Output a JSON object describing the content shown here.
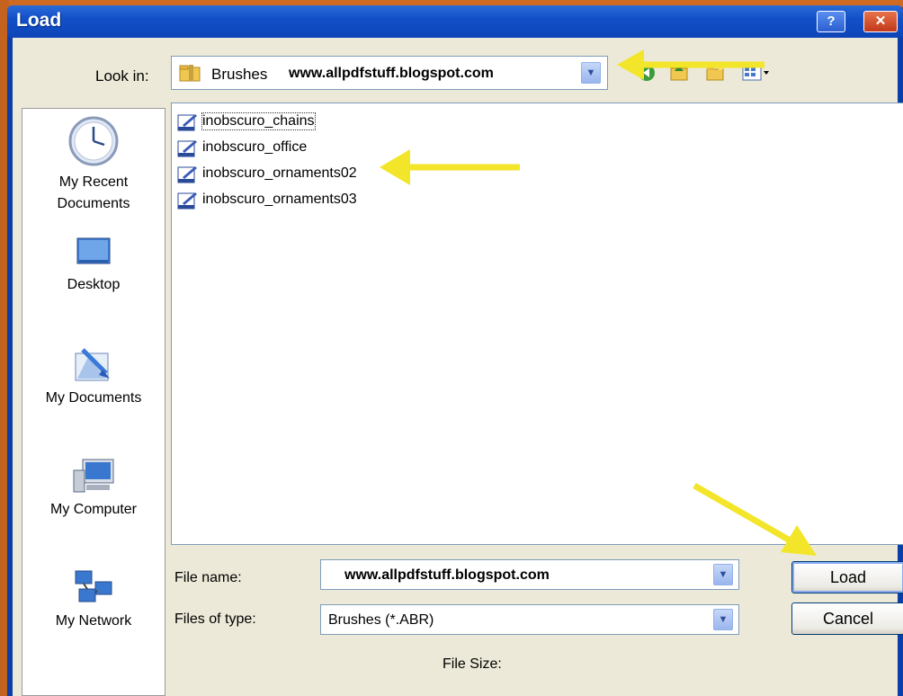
{
  "window": {
    "title": "Load",
    "help_label": "?",
    "close_label": "✕"
  },
  "lookin": {
    "label": "Look in:",
    "value": "Brushes",
    "watermark": "www.allpdfstuff.blogspot.com",
    "arrow": "▼"
  },
  "toolbar": {
    "icons": [
      "back-icon",
      "up-folder-icon",
      "new-folder-icon",
      "view-menu-icon"
    ]
  },
  "places": [
    {
      "label_line1": "My Recent",
      "label_line2": "Documents",
      "icon": "clock-icon"
    },
    {
      "label_line1": "Desktop",
      "label_line2": "",
      "icon": "desktop-icon"
    },
    {
      "label_line1": "My Documents",
      "label_line2": "",
      "icon": "my-documents-icon"
    },
    {
      "label_line1": "My Computer",
      "label_line2": "",
      "icon": "computer-icon"
    },
    {
      "label_line1": "My Network",
      "label_line2": "",
      "icon": "network-icon"
    }
  ],
  "files": [
    {
      "name": "inobscuro_chains",
      "selected": true
    },
    {
      "name": "inobscuro_office",
      "selected": false
    },
    {
      "name": "inobscuro_ornaments02",
      "selected": false
    },
    {
      "name": "inobscuro_ornaments03",
      "selected": false
    }
  ],
  "filename": {
    "label": "File name:",
    "value": "www.allpdfstuff.blogspot.com"
  },
  "filetype": {
    "label": "Files of type:",
    "value": "Brushes (*.ABR)"
  },
  "buttons": {
    "load": "Load",
    "cancel": "Cancel"
  },
  "file_size": {
    "label": "File Size:"
  },
  "colors": {
    "title_bar": "#1350c8",
    "client": "#ece9d8",
    "annotation_arrow": "#f2e52a"
  }
}
